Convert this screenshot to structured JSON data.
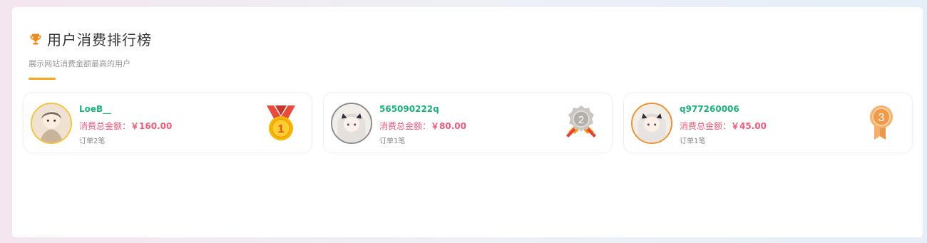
{
  "header": {
    "icon": "trophy-icon",
    "title": "用户消费排行榜",
    "subtitle": "展示网站消费金额最高的用户",
    "accent_color": "#f5a623"
  },
  "ranking": [
    {
      "rank": "1",
      "name": "LoeB__",
      "amount_label": "消费总金额：",
      "amount": "￥160.00",
      "orders": "订单2笔",
      "medal_icon": "gold-medal-icon",
      "border_color": "#f2c43d"
    },
    {
      "rank": "2",
      "name": "565090222q",
      "amount_label": "消费总金额：",
      "amount": "￥80.00",
      "orders": "订单1笔",
      "medal_icon": "silver-medal-icon",
      "border_color": "#8c8c8c"
    },
    {
      "rank": "3",
      "name": "q977260006",
      "amount_label": "消费总金额：",
      "amount": "￥45.00",
      "orders": "订单1笔",
      "medal_icon": "bronze-medal-icon",
      "border_color": "#f0902e"
    }
  ],
  "colors": {
    "name": "#19b27a",
    "amount": "#f05a7a"
  }
}
